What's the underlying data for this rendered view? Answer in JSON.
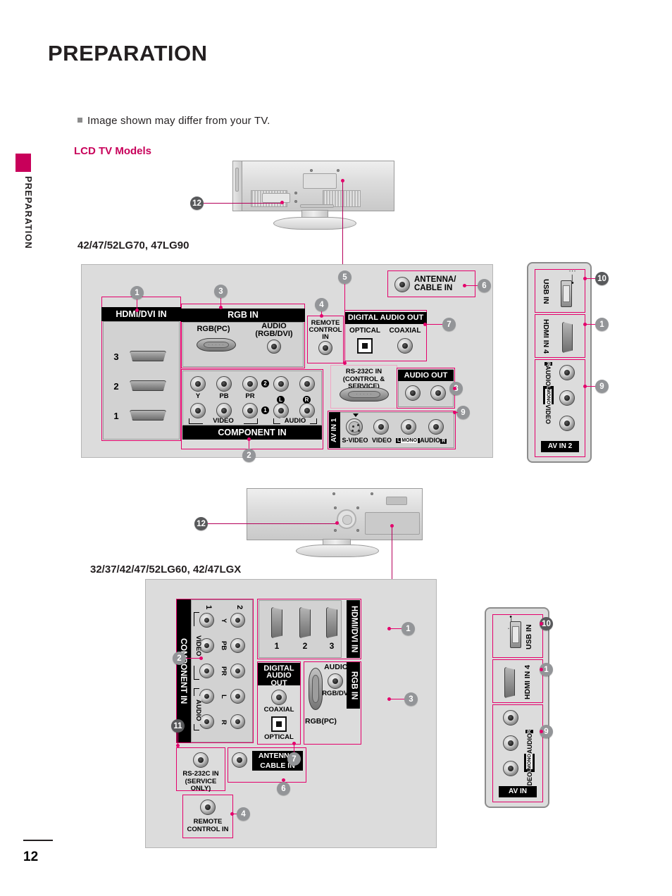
{
  "page": {
    "title": "PREPARATION",
    "side_tab": "PREPARATION",
    "number": "12",
    "note": "Image shown may differ from your TV.",
    "section_heading": "LCD TV Models",
    "accent_color": "#c8005a",
    "callout_color": "#e4006b",
    "bubble_color": "#939598"
  },
  "models": {
    "group1": "42/47/52LG70, 47LG90",
    "group2": "32/37/42/47/52LG60, 42/47LGX"
  },
  "panel1": {
    "hdmi": {
      "title": "HDMI/DVI IN",
      "ports": [
        "3",
        "2",
        "1"
      ]
    },
    "rgb": {
      "title": "RGB IN",
      "rgb_pc_label": "RGB(PC)",
      "audio_label_line1": "AUDIO",
      "audio_label_line2": "(RGB/DVI)"
    },
    "component": {
      "title": "COMPONENT IN",
      "labels": [
        "Y",
        "PB",
        "PR"
      ],
      "video_label": "VIDEO",
      "audio_label": "AUDIO",
      "audio_left": "L",
      "audio_right": "R",
      "set_1": "1",
      "set_2": "2"
    },
    "remote": {
      "line1": "REMOTE",
      "line2": "CONTROL IN"
    },
    "rs232c": {
      "line1": "RS-232C IN",
      "line2": "(CONTROL & SERVICE)"
    },
    "antenna": {
      "line1": "ANTENNA/",
      "line2": "CABLE IN"
    },
    "digital_audio_out": {
      "title": "DIGITAL AUDIO OUT",
      "optical": "OPTICAL",
      "coaxial": "COAXIAL"
    },
    "audio_out": {
      "title": "AUDIO OUT"
    },
    "av_in_1": {
      "title": "AV IN 1",
      "s_video": "S-VIDEO",
      "video": "VIDEO",
      "audio": "AUDIO",
      "mono_l": "L",
      "mono": "MONO",
      "right": "R"
    }
  },
  "side1": {
    "usb": "USB IN",
    "hdmi4": "HDMI IN 4",
    "video": "VIDEO",
    "audio": "AUDIO",
    "mono_l": "L",
    "mono": "MONO",
    "right": "R",
    "av_title": "AV IN 2"
  },
  "panel2": {
    "component": {
      "title": "COMPONENT IN",
      "col1": "1",
      "col2": "2",
      "video_label": "VIDEO",
      "audio_label": "AUDIO",
      "rows": [
        "Y",
        "PB",
        "PR",
        "L",
        "R"
      ]
    },
    "hdmi": {
      "title": "HDMI/DVI IN",
      "ports": [
        "1",
        "2",
        "3"
      ]
    },
    "digital_audio_out": {
      "line1": "DIGITAL",
      "line2": "AUDIO OUT",
      "coaxial": "COAXIAL",
      "optical": "OPTICAL"
    },
    "rgb": {
      "title": "RGB IN",
      "audio_label": "AUDIO",
      "audio_sub": "(RGB/DVI)",
      "rgb_pc_label": "RGB(PC)"
    },
    "rs232c": {
      "line1": "RS-232C IN",
      "line2": "(SERVICE ONLY)"
    },
    "antenna": {
      "line1": "ANTENNA/",
      "line2": "CABLE IN"
    },
    "remote": {
      "line1": "REMOTE",
      "line2": "CONTROL IN"
    }
  },
  "side2": {
    "usb": "USB IN",
    "hdmi4": "HDMI IN 4",
    "video": "VIDEO",
    "audio": "AUDIO",
    "mono_l": "L",
    "mono": "MONO",
    "right": "R",
    "av_title": "AV IN"
  },
  "callouts": {
    "c1": "1",
    "c2": "2",
    "c3": "3",
    "c4": "4",
    "c5": "5",
    "c6": "6",
    "c7": "7",
    "c8": "8",
    "c9": "9",
    "c10": "10",
    "c11": "11",
    "c12": "12"
  }
}
